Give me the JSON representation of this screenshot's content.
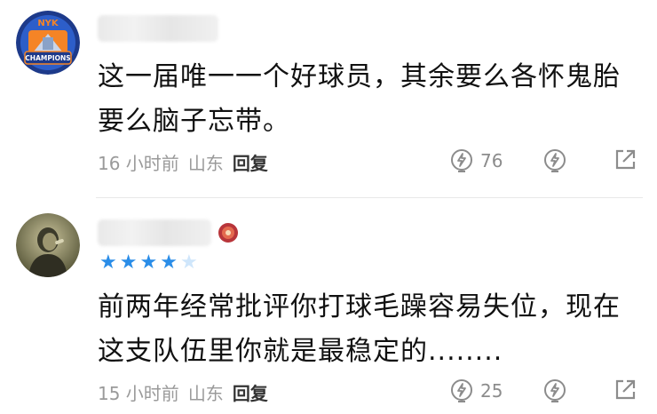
{
  "comments": [
    {
      "avatar_icon": "nyk-champions-avatar",
      "avatar_text": "CHAMPIONS",
      "avatar_top_text": "NYK",
      "username": "",
      "text": "这一届唯一一个好球员，其余要么各怀鬼胎\n要么脑子忘带。",
      "time": "16 小时前",
      "location": "山东",
      "reply_label": "回复",
      "likes": "76"
    },
    {
      "avatar_icon": "person-photo-avatar",
      "username": "",
      "stars_filled": 4,
      "stars_total": 5,
      "text": "前两年经常批评你打球毛躁容易失位，现在\n这支队伍里你就是最稳定的........",
      "time": "15 小时前",
      "location": "山东",
      "reply_label": "回复",
      "likes": "25"
    }
  ],
  "colors": {
    "star": "#2a8de8",
    "star_empty": "#cfe6fb",
    "meta": "#9a9a9a",
    "text": "#111111"
  }
}
